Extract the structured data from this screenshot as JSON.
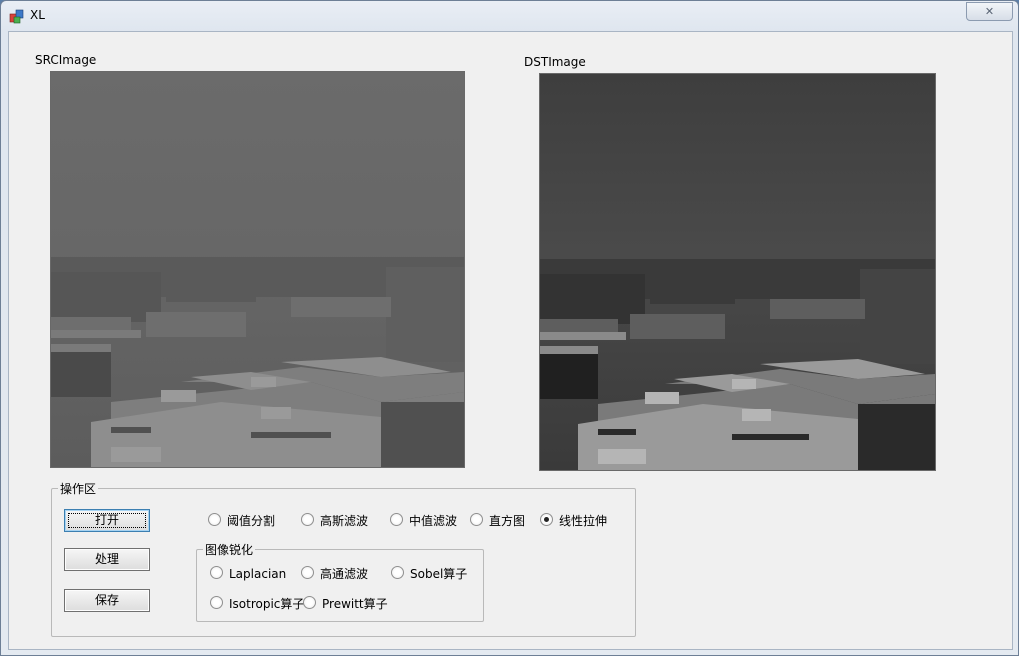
{
  "window": {
    "title": "XL",
    "close_glyph": "✕",
    "app_icon": "app-icon"
  },
  "images": {
    "src_label": "SRCImage",
    "dst_label": "DSTImage"
  },
  "ops_group": {
    "title": "操作区"
  },
  "buttons": {
    "open": "打开",
    "process": "处理",
    "save": "保存"
  },
  "radios": {
    "threshold": {
      "label": "阈值分割",
      "checked": false
    },
    "gaussian": {
      "label": "高斯滤波",
      "checked": false
    },
    "median": {
      "label": "中值滤波",
      "checked": false
    },
    "histogram": {
      "label": "直方图",
      "checked": false
    },
    "linear_stretch": {
      "label": "线性拉伸",
      "checked": true
    }
  },
  "sharpen_group": {
    "title": "图像锐化",
    "laplacian": "Laplacian",
    "highpass": "高通滤波",
    "sobel": "Sobel算子",
    "isotropic": "Isotropic算子",
    "prewitt": "Prewitt算子"
  }
}
